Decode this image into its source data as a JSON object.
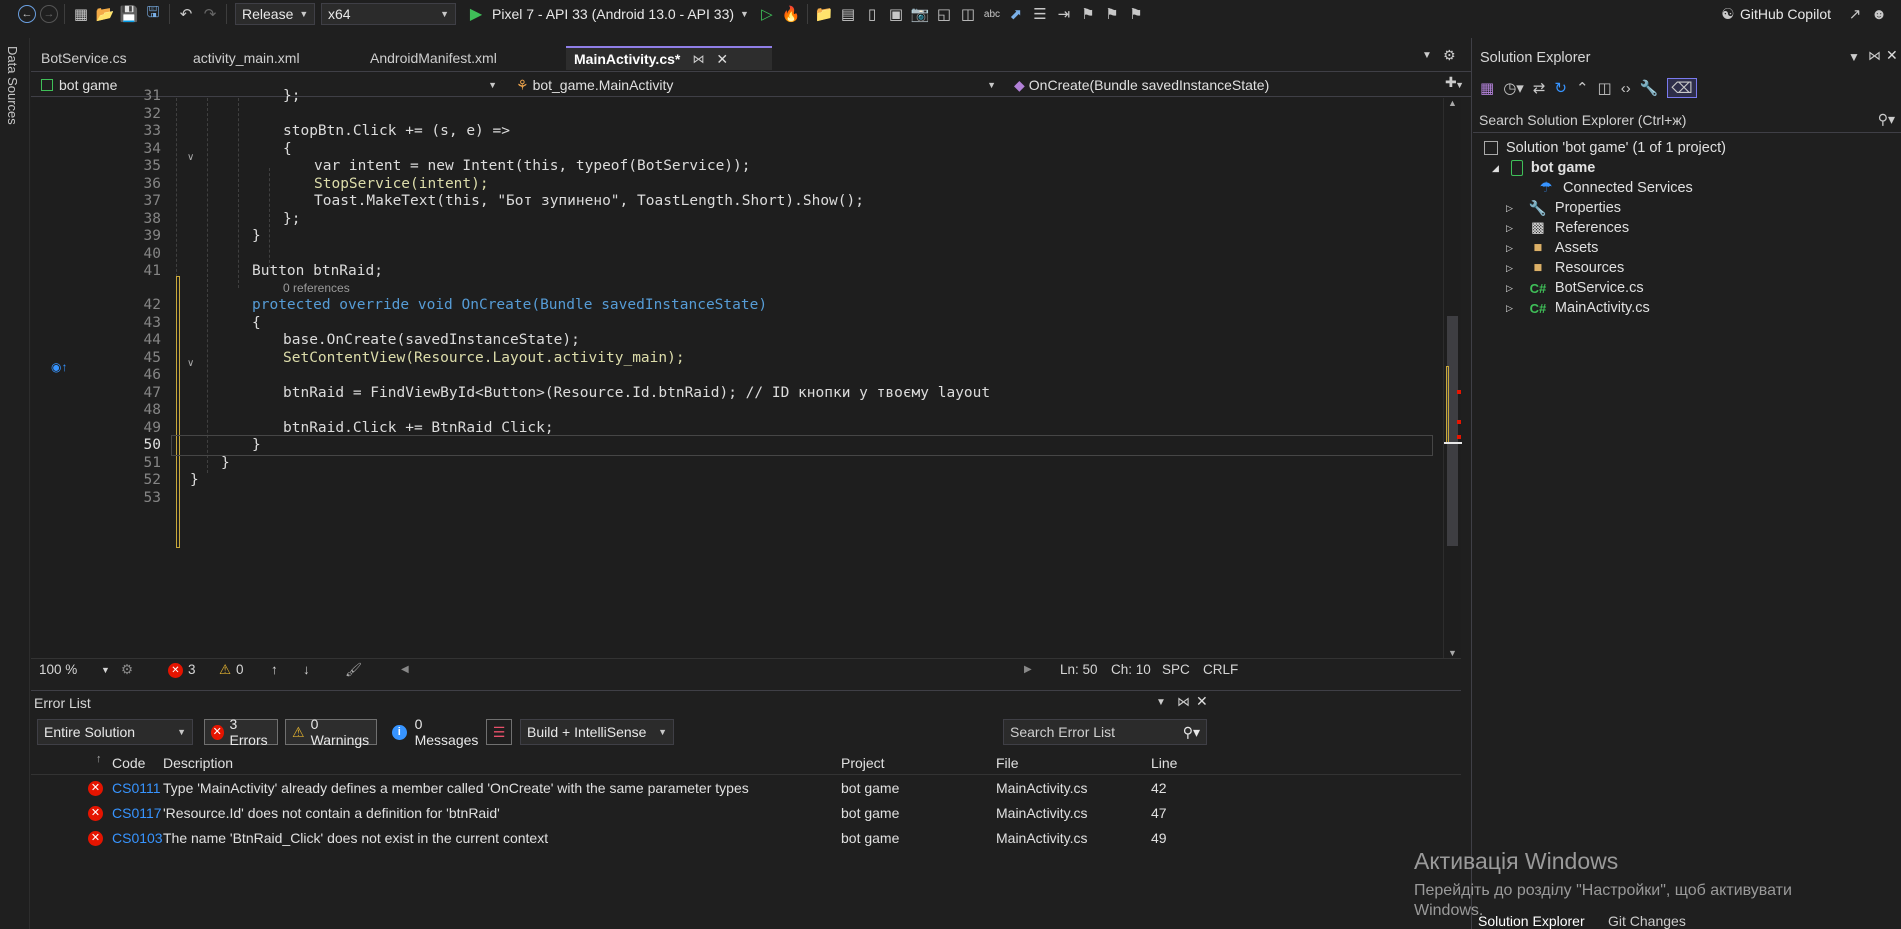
{
  "toolbar": {
    "config": "Release",
    "platform": "x64",
    "run_target": "Pixel 7 - API 33 (Android 13.0 - API 33)",
    "copilot": "GitHub Copilot"
  },
  "left_strip": {
    "label": "Data Sources"
  },
  "tabs": [
    {
      "label": "BotService.cs"
    },
    {
      "label": "activity_main.xml"
    },
    {
      "label": "AndroidManifest.xml"
    },
    {
      "label": "MainActivity.cs*"
    }
  ],
  "navbar": {
    "project": "bot game",
    "class": "bot_game.MainActivity",
    "member": "OnCreate(Bundle savedInstanceState)"
  },
  "code": {
    "refs_label": "0 references",
    "lines": [
      {
        "n": "31",
        "text": "};"
      },
      {
        "n": "32",
        "text": ""
      },
      {
        "n": "33",
        "text": "stopBtn.Click += (s, e) =>"
      },
      {
        "n": "34",
        "text": "{"
      },
      {
        "n": "35",
        "text": "var intent = new Intent(this, typeof(BotService));"
      },
      {
        "n": "36",
        "text": "StopService(intent);"
      },
      {
        "n": "37",
        "text": "Toast.MakeText(this, \"Бот зупинено\", ToastLength.Short).Show();"
      },
      {
        "n": "38",
        "text": "};"
      },
      {
        "n": "39",
        "text": "}"
      },
      {
        "n": "40",
        "text": ""
      },
      {
        "n": "41",
        "text": "Button btnRaid;"
      },
      {
        "n": "42",
        "text": "protected override void OnCreate(Bundle savedInstanceState)"
      },
      {
        "n": "43",
        "text": "{"
      },
      {
        "n": "44",
        "text": "base.OnCreate(savedInstanceState);"
      },
      {
        "n": "45",
        "text": "SetContentView(Resource.Layout.activity_main);"
      },
      {
        "n": "46",
        "text": ""
      },
      {
        "n": "47",
        "text": "btnRaid = FindViewById<Button>(Resource.Id.btnRaid); // ID кнопки у твоєму layout"
      },
      {
        "n": "48",
        "text": ""
      },
      {
        "n": "49",
        "text": "btnRaid.Click += BtnRaid_Click;"
      },
      {
        "n": "50",
        "text": "}"
      },
      {
        "n": "51",
        "text": "}"
      },
      {
        "n": "52",
        "text": "}"
      },
      {
        "n": "53",
        "text": ""
      }
    ]
  },
  "status": {
    "zoom": "100 %",
    "errors": "3",
    "warnings": "0",
    "ln": "Ln: 50",
    "ch": "Ch: 10",
    "spc": "SPC",
    "crlf": "CRLF"
  },
  "error_list": {
    "title": "Error List",
    "scope": "Entire Solution",
    "errors_chip": "3 Errors",
    "warnings_chip": "0 Warnings",
    "messages_chip": "0 Messages",
    "build_filter": "Build + IntelliSense",
    "search_placeholder": "Search Error List",
    "columns": [
      "Code",
      "Description",
      "Project",
      "File",
      "Line"
    ],
    "rows": [
      {
        "code": "CS0111",
        "description": "Type 'MainActivity' already defines a member called 'OnCreate' with the same parameter types",
        "project": "bot game",
        "file": "MainActivity.cs",
        "line": "42"
      },
      {
        "code": "CS0117",
        "description": "'Resource.Id' does not contain a definition for 'btnRaid'",
        "project": "bot game",
        "file": "MainActivity.cs",
        "line": "47"
      },
      {
        "code": "CS0103",
        "description": "The name 'BtnRaid_Click' does not exist in the current context",
        "project": "bot game",
        "file": "MainActivity.cs",
        "line": "49"
      }
    ]
  },
  "solution_explorer": {
    "title": "Solution Explorer",
    "search_placeholder": "Search Solution Explorer (Ctrl+ж)",
    "solution": "Solution 'bot game' (1 of 1 project)",
    "project": "bot game",
    "items": [
      "Connected Services",
      "Properties",
      "References",
      "Assets",
      "Resources",
      "BotService.cs",
      "MainActivity.cs"
    ],
    "bottom_tabs": [
      "Solution Explorer",
      "Git Changes"
    ]
  },
  "watermark": {
    "title": "Активація Windows",
    "line1": "Перейдіть до розділу \"Настройки\", щоб активувати",
    "line2": "Windows."
  }
}
